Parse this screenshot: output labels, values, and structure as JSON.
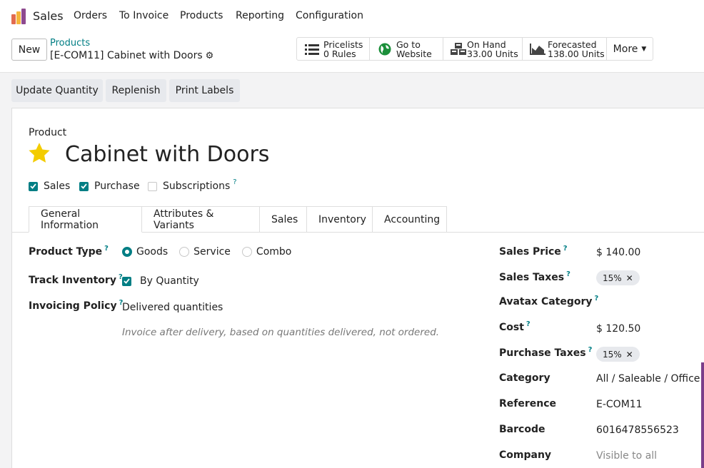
{
  "nav": {
    "app_name": "Sales",
    "items": [
      "Orders",
      "To Invoice",
      "Products",
      "Reporting",
      "Configuration"
    ]
  },
  "control": {
    "new_label": "New",
    "breadcrumb": "Products",
    "record": "[E-COM11] Cabinet with Doors",
    "smart_buttons": [
      {
        "line1": "Pricelists",
        "line2": "0 Rules",
        "icon": "list-icon"
      },
      {
        "line1": "Go to",
        "line2": "Website",
        "icon": "globe-icon"
      },
      {
        "line1": "On Hand",
        "line2": "33.00 Units",
        "icon": "cubes-icon"
      },
      {
        "line1": "Forecasted",
        "line2": "138.00 Units",
        "icon": "area-chart-icon"
      }
    ],
    "more_label": "More"
  },
  "actions": [
    "Update Quantity",
    "Replenish",
    "Print Labels"
  ],
  "form": {
    "product_label": "Product",
    "name": "Cabinet with Doors",
    "checkboxes": [
      {
        "label": "Sales",
        "checked": true
      },
      {
        "label": "Purchase",
        "checked": true
      },
      {
        "label": "Subscriptions",
        "checked": false,
        "help": "?"
      }
    ],
    "tabs": [
      "General Information",
      "Attributes & Variants",
      "Sales",
      "Inventory",
      "Accounting"
    ],
    "left": {
      "product_type_label": "Product Type",
      "product_type_options": [
        "Goods",
        "Service",
        "Combo"
      ],
      "product_type_selected": "Goods",
      "track_inventory_label": "Track Inventory",
      "track_inventory_value": "By Quantity",
      "invoicing_policy_label": "Invoicing Policy",
      "invoicing_policy_value": "Delivered quantities",
      "invoicing_hint": "Invoice after delivery, based on quantities delivered, not ordered."
    },
    "right": {
      "sales_price_label": "Sales Price",
      "sales_price": "$ 140.00",
      "sales_taxes_label": "Sales Taxes",
      "sales_tax_tag": "15%",
      "avatax_label": "Avatax Category",
      "cost_label": "Cost",
      "cost": "$ 120.50",
      "purchase_taxes_label": "Purchase Taxes",
      "purchase_tax_tag": "15%",
      "category_label": "Category",
      "category": "All / Saleable / Office Fu",
      "reference_label": "Reference",
      "reference": "E-COM11",
      "barcode_label": "Barcode",
      "barcode": "6016478556523",
      "company_label": "Company",
      "company": "Visible to all"
    },
    "help_mark": "?"
  },
  "colors": {
    "accent": "#017e84",
    "star": "#f3cc00",
    "tag_bg": "#e7e9ed"
  }
}
